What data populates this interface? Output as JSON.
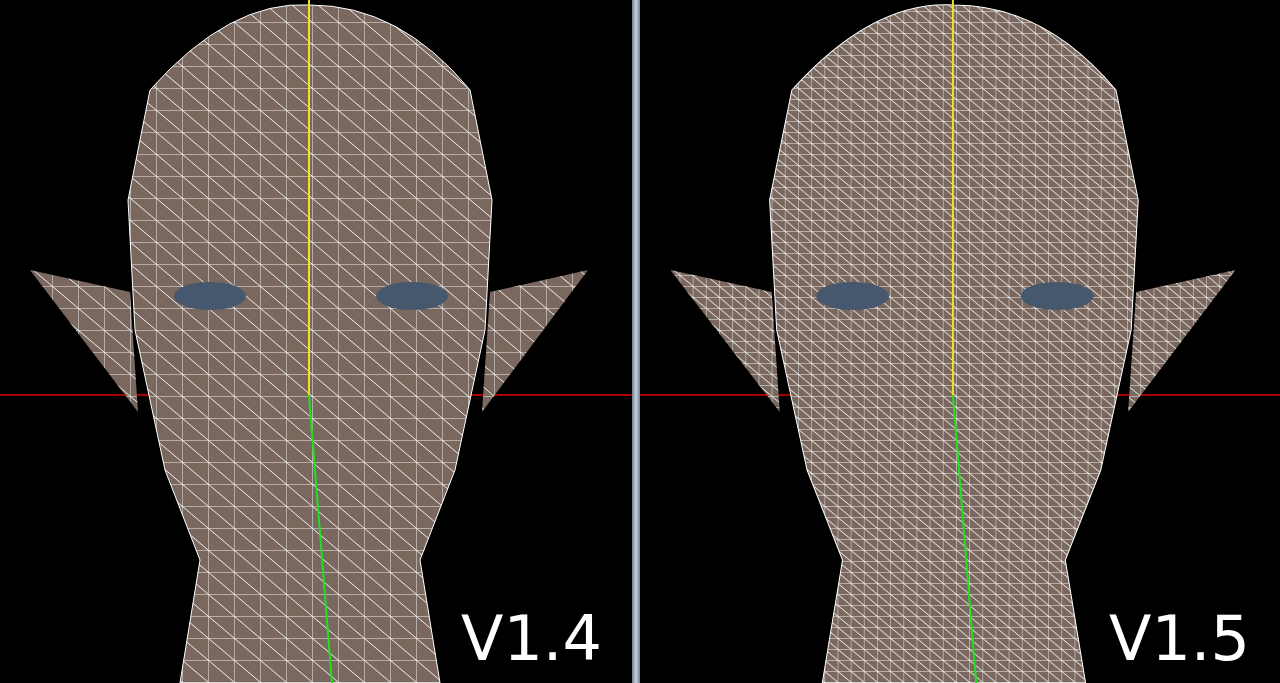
{
  "panels": [
    {
      "label": "V1.4"
    },
    {
      "label": "V1.5"
    }
  ]
}
